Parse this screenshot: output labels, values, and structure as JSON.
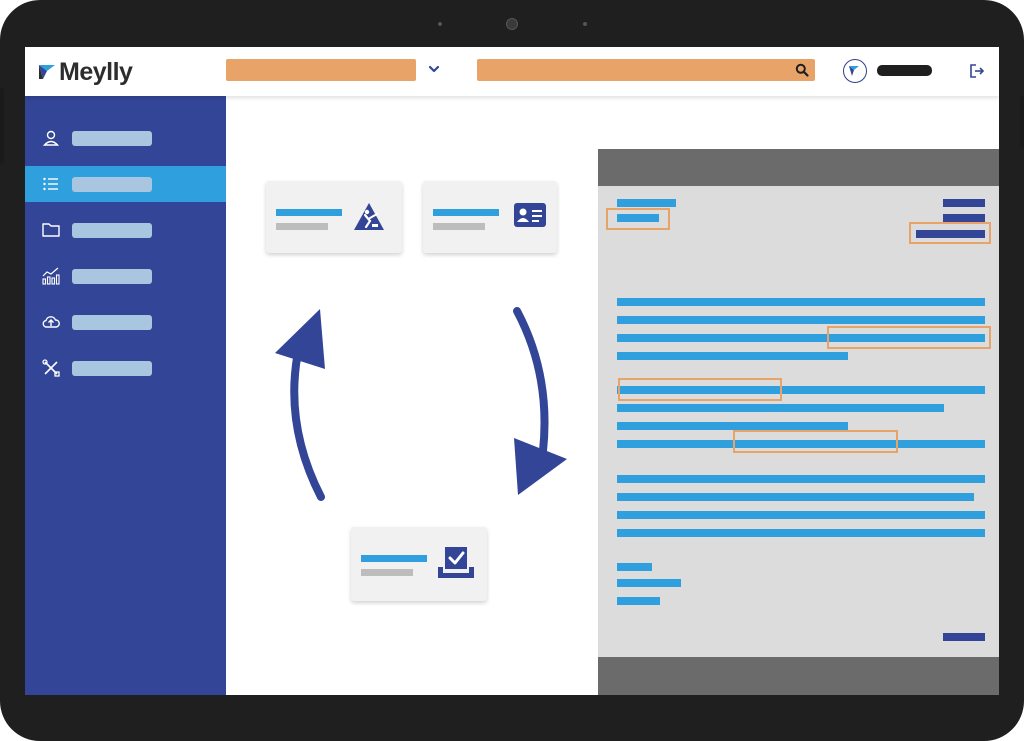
{
  "app": {
    "name": "Meylly"
  },
  "header": {
    "select_value": "",
    "search_placeholder": "",
    "username": ""
  },
  "sidebar": {
    "items": [
      {
        "icon": "user-icon",
        "label": ""
      },
      {
        "icon": "list-icon",
        "label": "",
        "active": true
      },
      {
        "icon": "folder-icon",
        "label": ""
      },
      {
        "icon": "chart-icon",
        "label": ""
      },
      {
        "icon": "cloud-upload-icon",
        "label": ""
      },
      {
        "icon": "tools-icon",
        "label": ""
      }
    ]
  },
  "workflow": {
    "cards": [
      {
        "icon": "construction-icon"
      },
      {
        "icon": "id-card-icon"
      },
      {
        "icon": "approved-tray-icon"
      }
    ],
    "center_icon": "gear-icon",
    "arrows": [
      "rotate-arrow-left-icon",
      "rotate-arrow-right-icon"
    ]
  },
  "colors": {
    "brand_dark": "#334596",
    "brand_light": "#2f9fde",
    "highlight": "#e8a468",
    "sidebar_label": "#a9c6e0",
    "card_bg": "#f1f1f1",
    "doc_bg": "#dcdcdc",
    "doc_frame": "#6b6b6b",
    "device": "#1f1f1f"
  }
}
